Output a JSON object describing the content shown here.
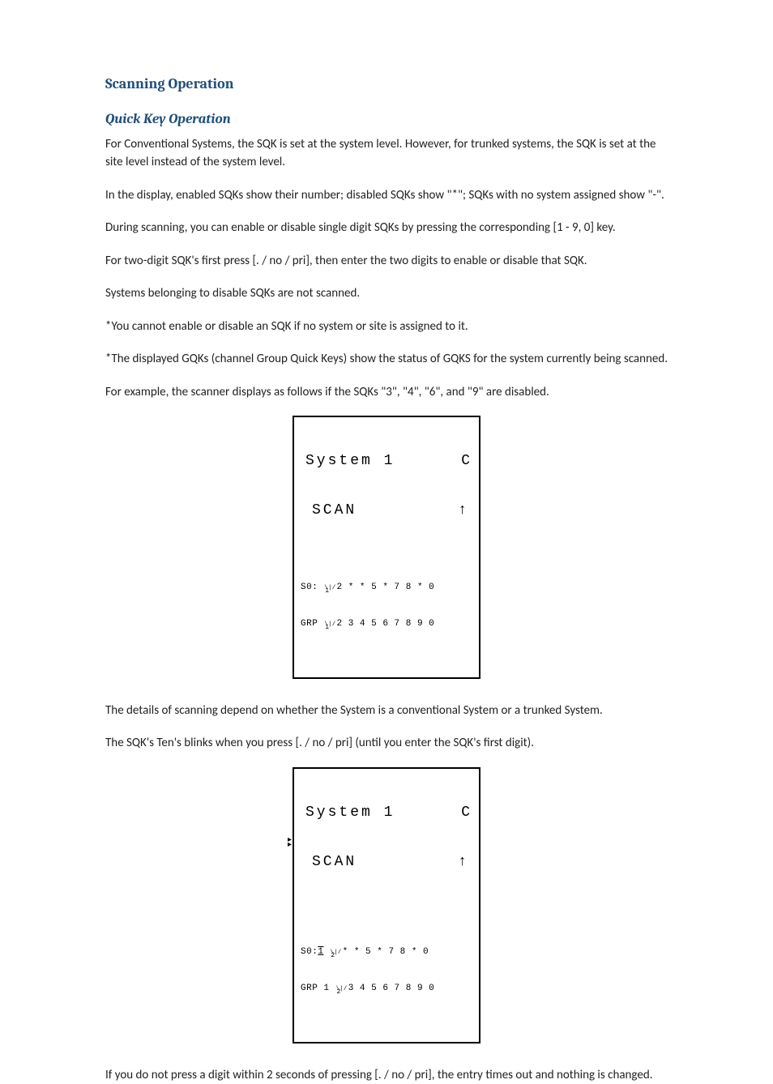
{
  "headings": {
    "h1": "Scanning Operation",
    "h2": "Quick Key Operation"
  },
  "paragraphs": {
    "p1": "For Conventional Systems, the SQK is set at the system level. However, for trunked systems, the SQK is set at the site level instead of the system level.",
    "p2": "In the display, enabled SQKs show their number; disabled SQKs show \"*\"; SQKs with no system assigned show \"-\".",
    "p3": "During scanning, you can enable or disable single digit SQKs by pressing the corresponding [1 - 9, 0] key.",
    "p4": "For two-digit SQK's first press [. / no / pri], then enter the two digits to enable or disable that SQK.",
    "p5": "Systems belonging to disable SQKs are not scanned.",
    "p6": "*You cannot enable or disable an SQK if no system or site is assigned to it.",
    "p7": "*The displayed GQKs (channel Group Quick Keys) show the status of GQKS for the system currently being scanned.",
    "p8": "For example, the scanner displays as follows if the SQKs \"3\", \"4\", \"6\", and \"9\" are disabled.",
    "p9": "The details of scanning depend on whether the System is a conventional System or a trunked System.",
    "p10": "The SQK's Ten's blinks when you press [. / no / pri] (until you enter the SQK's first digit).",
    "p11": "If you do not press a digit within 2 seconds of pressing [. / no / pri], the entry times out and nothing is changed."
  },
  "lcd1": {
    "systemLabel": "System 1",
    "mode": "C",
    "scan": "SCAN",
    "s0_prefix": "S0:",
    "s0_values": "1 2 * * 5 * 7 8 * 0",
    "grp_prefix": "GRP",
    "grp_values": "1 2 3 4 5 6 7 8 9 0"
  },
  "lcd2": {
    "systemLabel": "System 1",
    "mode": "C",
    "scan": "SCAN",
    "s0_prefix": "S0:",
    "s0_blink": "1",
    "s0_values": "2 * * 5 * 7 8 * 0",
    "grp_prefix": "GRP",
    "grp_values": "1 2 3 4 5 6 7 8 9 0"
  }
}
